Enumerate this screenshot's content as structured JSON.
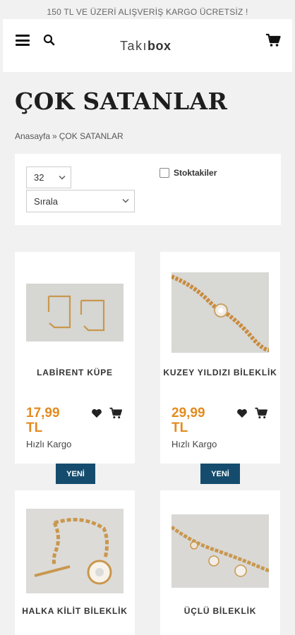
{
  "promo": {
    "text": "150 TL VE ÜZERİ ALIŞVERİŞ KARGO ÜCRETSİZ !"
  },
  "header": {
    "logo_part1": "Takı",
    "logo_part2": "box",
    "menu_icon": "hamburger-menu-icon",
    "search_icon": "search-icon",
    "cart_icon": "shopping-cart-icon"
  },
  "page": {
    "title": "ÇOK SATANLAR",
    "breadcrumb": {
      "home": "Anasayfa",
      "separator": "»",
      "current": "ÇOK SATANLAR"
    }
  },
  "filters": {
    "per_page": "32",
    "sort": "Sırala",
    "in_stock_label": "Stoktakiler",
    "in_stock_checked": false
  },
  "products": [
    {
      "name": "LABİRENT KÜPE",
      "price": "17,99",
      "currency": "TL",
      "shipping": "Hızlı Kargo",
      "badge": "YENİ"
    },
    {
      "name": "KUZEY YILDIZI BİLEKLİK",
      "price": "29,99",
      "currency": "TL",
      "shipping": "Hızlı Kargo",
      "badge": "YENİ"
    },
    {
      "name": "HALKA KİLİT BİLEKLİK"
    },
    {
      "name": "ÜÇLÜ BİLEKLİK"
    }
  ],
  "colors": {
    "price": "#e38b1f",
    "badge": "#154c6e",
    "background": "#f1f1f1"
  }
}
